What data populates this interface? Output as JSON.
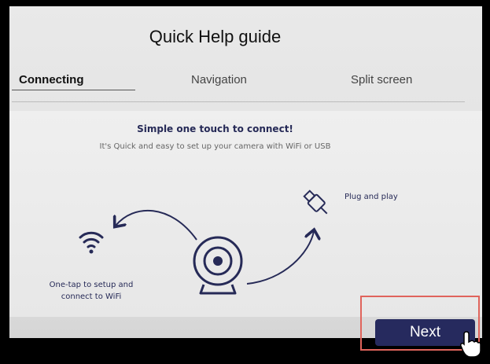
{
  "header": {
    "title": "Quick Help guide"
  },
  "tabs": [
    {
      "label": "Connecting",
      "active": true
    },
    {
      "label": "Navigation",
      "active": false
    },
    {
      "label": "Split screen",
      "active": false
    }
  ],
  "panel": {
    "heading": "Simple one touch to connect!",
    "subheading": "It's Quick and easy to set up your camera with WiFi or USB",
    "wifi_label_line1": "One-tap to setup and",
    "wifi_label_line2": "connect to WiFi",
    "plug_label": "Plug and play"
  },
  "footer": {
    "next_label": "Next"
  },
  "icons": {
    "wifi": "wifi-icon",
    "camera": "webcam-icon",
    "usb": "usb-plug-icon",
    "cursor": "hand-cursor-icon"
  },
  "colors": {
    "accent": "#262a5e",
    "highlight": "#e0645c"
  }
}
